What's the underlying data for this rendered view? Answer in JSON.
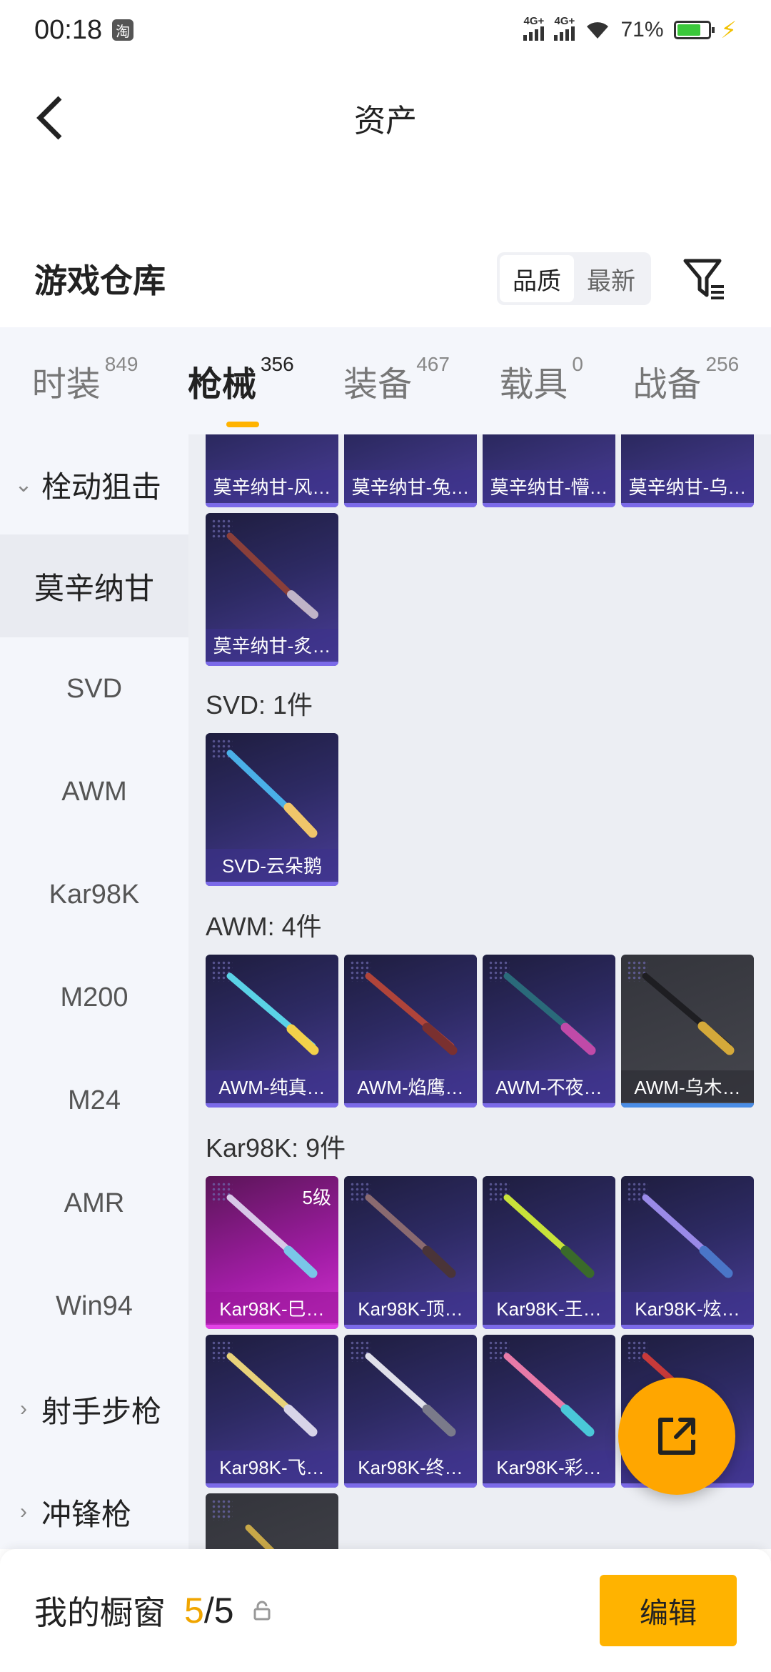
{
  "status_bar": {
    "time": "00:18",
    "app_badge": "淘",
    "net1": "4G+",
    "net2": "4G+",
    "battery": "71%"
  },
  "nav": {
    "title": "资产"
  },
  "warehouse": {
    "title": "游戏仓库",
    "sort_options": [
      "品质",
      "最新"
    ]
  },
  "tabs": [
    {
      "label": "时装",
      "count": "849"
    },
    {
      "label": "枪械",
      "count": "356"
    },
    {
      "label": "装备",
      "count": "467"
    },
    {
      "label": "载具",
      "count": "0"
    },
    {
      "label": "战备",
      "count": "256"
    }
  ],
  "sidebar": {
    "group_open": "栓动狙击",
    "items": [
      "莫辛纳甘",
      "SVD",
      "AWM",
      "Kar98K",
      "M200",
      "M24",
      "AMR",
      "Win94"
    ],
    "group2": "射手步枪",
    "group3": "冲锋枪"
  },
  "sections": {
    "mosin_cards": [
      "莫辛纳甘-风…",
      "莫辛纳甘-兔…",
      "莫辛纳甘-懵…",
      "莫辛纳甘-乌…",
      "莫辛纳甘-炙…"
    ],
    "svd_title": "SVD: 1件",
    "svd_cards": [
      "SVD-云朵鹅"
    ],
    "awm_title": "AWM: 4件",
    "awm_cards": [
      "AWM-纯真…",
      "AWM-焰鹰…",
      "AWM-不夜…",
      "AWM-乌木…"
    ],
    "kar_title": "Kar98K: 9件",
    "kar_level": "5级",
    "kar_cards": [
      "Kar98K-巳…",
      "Kar98K-顶…",
      "Kar98K-王…",
      "Kar98K-炫…",
      "Kar98K-飞…",
      "Kar98K-终…",
      "Kar98K-彩…",
      "…"
    ]
  },
  "bottom": {
    "title": "我的橱窗",
    "count_current": "5",
    "count_total": "/5",
    "edit_label": "编辑"
  },
  "colors": {
    "accent": "#ffb300",
    "card_purple": "#2d2a63",
    "card_pink": "#a21da6",
    "card_gray": "#46474e"
  }
}
